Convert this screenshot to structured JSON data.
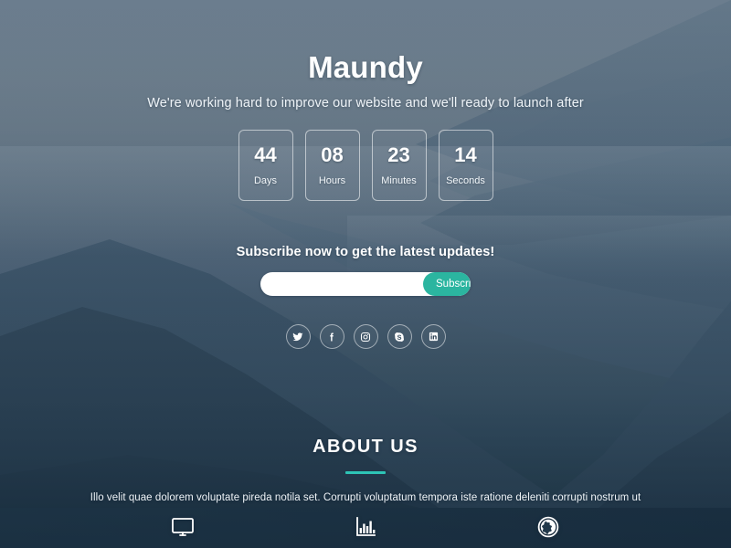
{
  "theme": {
    "accent": "#2bb5a0",
    "rule_color": "#2ec4b6",
    "text_color": "#ffffff",
    "bg_top": "#6b7d8e",
    "bg_bottom": "#21394a"
  },
  "hero": {
    "title": "Maundy",
    "tagline": "We're working hard to improve our website and we'll ready to launch after"
  },
  "countdown": {
    "units": [
      {
        "value": "44",
        "label": "Days"
      },
      {
        "value": "08",
        "label": "Hours"
      },
      {
        "value": "23",
        "label": "Minutes"
      },
      {
        "value": "14",
        "label": "Seconds"
      }
    ]
  },
  "subscribe": {
    "heading": "Subscribe now to get the latest updates!",
    "input_value": "",
    "input_placeholder": "",
    "button_label": "Subscribe"
  },
  "social": {
    "links": [
      {
        "name": "twitter",
        "title": "Twitter"
      },
      {
        "name": "facebook",
        "title": "Facebook"
      },
      {
        "name": "instagram",
        "title": "Instagram"
      },
      {
        "name": "skype",
        "title": "Skype"
      },
      {
        "name": "linkedin",
        "title": "LinkedIn"
      }
    ]
  },
  "about": {
    "title": "ABOUT US",
    "text": "Illo velit quae dolorem voluptate pireda notila set. Corrupti voluptatum tempora iste ratione deleniti corrupti nostrum ut"
  },
  "features": {
    "items": [
      {
        "name": "desktop-icon"
      },
      {
        "name": "bar-chart-icon"
      },
      {
        "name": "globe-icon"
      }
    ]
  }
}
